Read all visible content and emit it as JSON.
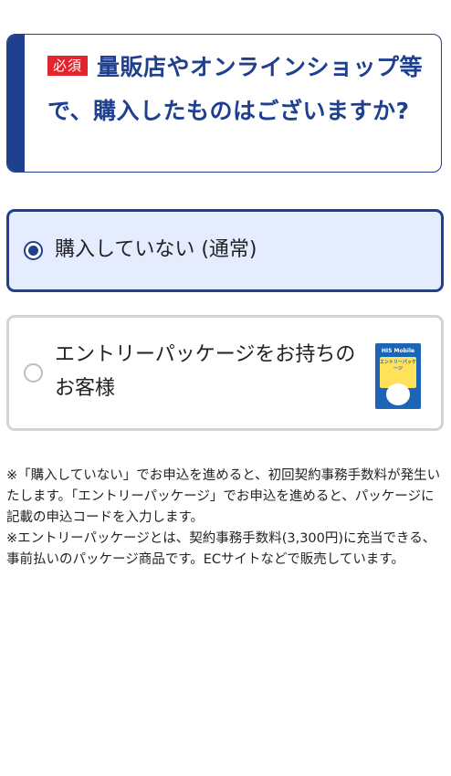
{
  "question": {
    "required_badge": "必須",
    "text": "量販店やオンラインショップ等で、購入したものはございますか?"
  },
  "options": [
    {
      "label": "購入していない (通常)",
      "selected": true
    },
    {
      "label": "エントリーパッケージをお持ちのお客様",
      "selected": false,
      "image_brand": "HIS Mobile",
      "image_title": "エントリーパッケージ"
    }
  ],
  "notes": [
    "※「購入していない」でお申込を進めると、初回契約事務手数料が発生いたします。「エントリーパッケージ」でお申込を進めると、パッケージに記載の申込コードを入力します。",
    "※エントリーパッケージとは、契約事務手数料(3,300円)に充当できる、事前払いのパッケージ商品です。ECサイトなどで販売しています。"
  ],
  "colors": {
    "primary": "#1f3f8f",
    "required": "#e0262c",
    "selected_bg": "#e4ecfe",
    "border_gray": "#d3d3d3"
  }
}
